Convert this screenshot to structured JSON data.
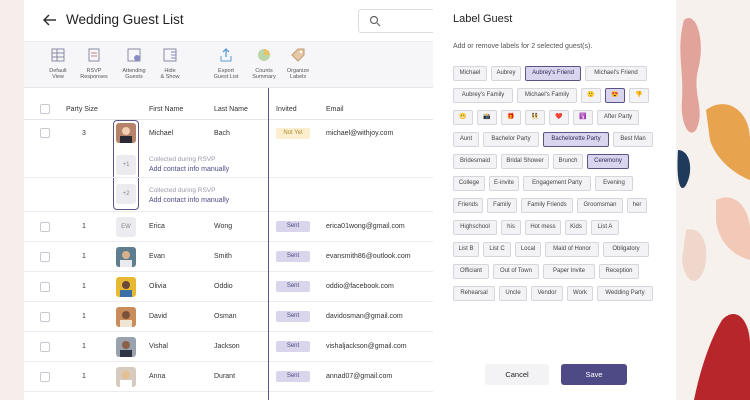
{
  "header": {
    "title": "Wedding Guest List",
    "search_placeholder": ""
  },
  "toolbar": [
    {
      "label1": "Default",
      "label2": "View",
      "icon": "table-icon"
    },
    {
      "label1": "RSVP",
      "label2": "Responses",
      "icon": "rsvp-icon"
    },
    {
      "label1": "Attending",
      "label2": "Guests",
      "icon": "attending-icon"
    },
    {
      "label1": "Hide",
      "label2": "& Show",
      "icon": "hide-show-icon"
    },
    {
      "label1": "Export",
      "label2": "Guest List",
      "icon": "export-icon"
    },
    {
      "label1": "Counts",
      "label2": "Summary",
      "icon": "pie-icon"
    },
    {
      "label1": "Organize",
      "label2": "Labels",
      "icon": "tag-icon"
    }
  ],
  "table": {
    "columns": [
      "Party Size",
      "First Name",
      "Last Name",
      "Invited",
      "Email"
    ],
    "rows": [
      {
        "party": "3",
        "first": "Michael",
        "last": "Bach",
        "invited": "Not Yet",
        "email": "michael@withjoy.com"
      },
      {
        "party": "1",
        "initials": "EW",
        "first": "Erica",
        "last": "Wong",
        "invited": "Sent",
        "email": "erica01wong@gmail.com"
      },
      {
        "party": "1",
        "first": "Evan",
        "last": "Smith",
        "invited": "Sent",
        "email": "evansmith86@outlook.com"
      },
      {
        "party": "1",
        "first": "Olivia",
        "last": "Oddio",
        "invited": "Sent",
        "email": "oddio@facebook.com"
      },
      {
        "party": "1",
        "first": "David",
        "last": "Osman",
        "invited": "Sent",
        "email": "davidosman@gmail.com"
      },
      {
        "party": "1",
        "first": "Vishal",
        "last": "Jackson",
        "invited": "Sent",
        "email": "vishaljackson@gmail.com"
      },
      {
        "party": "1",
        "first": "Anna",
        "last": "Durant",
        "invited": "Sent",
        "email": "annad07@gmail.com"
      }
    ],
    "subguests": [
      {
        "placeholder": "+1",
        "note": "Collected during RSVP",
        "link": "Add contact info manually"
      },
      {
        "placeholder": "+2",
        "note": "Collected during RSVP",
        "link": "Add contact info manually"
      }
    ]
  },
  "modal": {
    "title": "Label Guest",
    "subtitle": "Add or remove labels for 2 selected guest(s).",
    "labels": [
      {
        "text": "Michael",
        "selected": false
      },
      {
        "text": "Aubrey",
        "selected": false
      },
      {
        "text": "Aubrey's Friend",
        "selected": true
      },
      {
        "text": "Michael's Friend",
        "selected": false
      },
      {
        "text": "Aubrey's Family",
        "selected": false
      },
      {
        "text": "Michael's Family",
        "selected": false
      },
      {
        "text": "🙂",
        "selected": false
      },
      {
        "text": "😍",
        "selected": true
      },
      {
        "text": "👎",
        "selected": false
      },
      {
        "text": "😬",
        "selected": false
      },
      {
        "text": "📸",
        "selected": false
      },
      {
        "text": "🎁",
        "selected": false
      },
      {
        "text": "👯",
        "selected": false
      },
      {
        "text": "❤️",
        "selected": false
      },
      {
        "text": "🛐",
        "selected": false
      },
      {
        "text": "After Party",
        "selected": false
      },
      {
        "text": "Aunt",
        "selected": false
      },
      {
        "text": "Bachelor Party",
        "selected": false
      },
      {
        "text": "Bachelorette Party",
        "selected": true
      },
      {
        "text": "Best Man",
        "selected": false
      },
      {
        "text": "Bridesmaid",
        "selected": false
      },
      {
        "text": "Bridal Shower",
        "selected": false
      },
      {
        "text": "Brunch",
        "selected": false
      },
      {
        "text": "Ceremony",
        "selected": true
      },
      {
        "text": "College",
        "selected": false
      },
      {
        "text": "E-invite",
        "selected": false
      },
      {
        "text": "Engagement Party",
        "selected": false
      },
      {
        "text": "Evening",
        "selected": false
      },
      {
        "text": "Friends",
        "selected": false
      },
      {
        "text": "Family",
        "selected": false
      },
      {
        "text": "Family Friends",
        "selected": false
      },
      {
        "text": "Groomsman",
        "selected": false
      },
      {
        "text": "her",
        "selected": false
      },
      {
        "text": "Highschool",
        "selected": false
      },
      {
        "text": "his",
        "selected": false
      },
      {
        "text": "Hot mess",
        "selected": false
      },
      {
        "text": "Kids",
        "selected": false
      },
      {
        "text": "List A",
        "selected": false
      },
      {
        "text": "List B",
        "selected": false
      },
      {
        "text": "List C",
        "selected": false
      },
      {
        "text": "Local",
        "selected": false
      },
      {
        "text": "Maid of Honor",
        "selected": false
      },
      {
        "text": "Obligatory",
        "selected": false
      },
      {
        "text": "Officiant",
        "selected": false
      },
      {
        "text": "Out of Town",
        "selected": false
      },
      {
        "text": "Paper Invite",
        "selected": false
      },
      {
        "text": "Reception",
        "selected": false
      },
      {
        "text": "Rehearsal",
        "selected": false
      },
      {
        "text": "Uncle",
        "selected": false
      },
      {
        "text": "Vendor",
        "selected": false
      },
      {
        "text": "Work",
        "selected": false
      },
      {
        "text": "Wedding Party",
        "selected": false
      }
    ],
    "cancel_label": "Cancel",
    "save_label": "Save"
  },
  "colors": {
    "accent": "#4d4a85",
    "selected_chip": "#d9d5ef",
    "not_yet": "#fcefcf",
    "sent": "#d9d5ec"
  }
}
